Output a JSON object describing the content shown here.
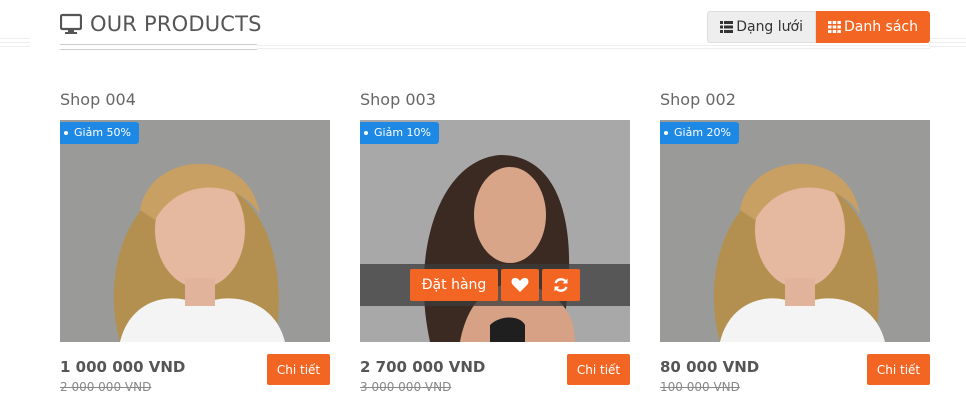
{
  "header": {
    "title": "OUR PRODUCTS",
    "grid_label": "Dạng lưới",
    "list_label": "Danh sách"
  },
  "colors": {
    "accent": "#f26522",
    "badge": "#1e88e5"
  },
  "products": [
    {
      "shop": "Shop 004",
      "badge": "Giảm 50%",
      "price": "1 000 000 VND",
      "old_price": "2 000 000 VND",
      "detail": "Chi tiết"
    },
    {
      "shop": "Shop 003",
      "badge": "Giảm 10%",
      "price": "2 700 000 VND",
      "old_price": "3 000 000 VND",
      "detail": "Chi tiết",
      "overlay": {
        "order_label": "Đặt hàng",
        "wishlist_icon": "heart-icon",
        "compare_icon": "refresh-icon"
      }
    },
    {
      "shop": "Shop 002",
      "badge": "Giảm 20%",
      "price": "80 000 VND",
      "old_price": "100 000 VND",
      "detail": "Chi tiết"
    }
  ]
}
